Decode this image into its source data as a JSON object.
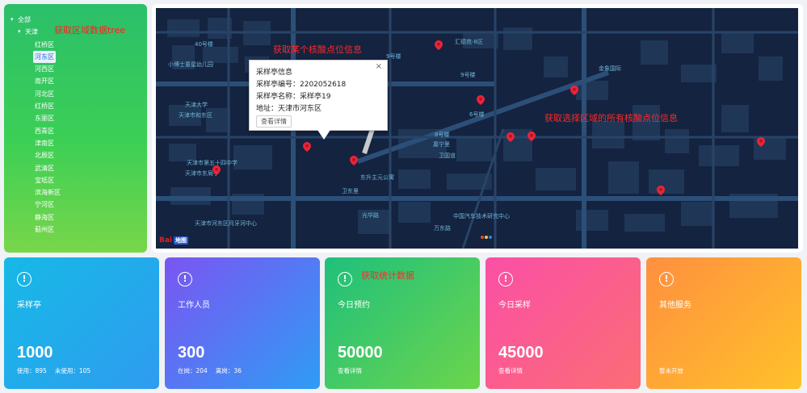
{
  "tree": {
    "annotation": "获取区域数据tree",
    "root": "全部",
    "city": "天津",
    "districts": [
      "红桥区",
      "河东区",
      "河西区",
      "南开区",
      "河北区",
      "红桥区",
      "东丽区",
      "西青区",
      "津南区",
      "北辰区",
      "武清区",
      "宝坻区",
      "滨海新区",
      "宁河区",
      "静海区",
      "蓟州区"
    ],
    "selected_index": 1
  },
  "map": {
    "annotation_point": "获取某个核酸点位信息",
    "annotation_region": "获取选择区域的所有核酸点位信息",
    "labels": [
      "40号楼",
      "小博士童星幼儿园",
      "天津大学",
      "天津市和东区",
      "天津市第五十四中学",
      "天津市东局子",
      "9号楼",
      "汇德苑-8区",
      "金象国际",
      "9号楼",
      "6号楼",
      "8号楼",
      "嘉宁里",
      "卫国道",
      "东升主元公寓",
      "光华路",
      "中国汽车技术研究中心",
      "万东路",
      "卫东里",
      "天津市河东区月牙河中心"
    ],
    "popup": {
      "title": "采样亭信息",
      "code": "采样亭编号：2202052618",
      "name": "采样亭名称：采样亭19",
      "address": "地址：天津市河东区",
      "button": "查看详情"
    },
    "logo_text": "Bai",
    "logo_badge": "地图"
  },
  "cards_annotation": "获取统计数据",
  "cards": [
    {
      "title": "采样亭",
      "value": "1000",
      "footer": [
        "使用：895",
        "未使用：105"
      ],
      "gradient": [
        "#16b9e6",
        "#2f9cf0"
      ]
    },
    {
      "title": "工作人员",
      "value": "300",
      "footer": [
        "在岗：204",
        "离岗：36"
      ],
      "gradient": [
        "#7b55f2",
        "#2f9cf5"
      ]
    },
    {
      "title": "今日预约",
      "value": "50000",
      "footer": [
        "查看详情"
      ],
      "gradient": [
        "#1fc07c",
        "#6cd54c"
      ]
    },
    {
      "title": "今日采样",
      "value": "45000",
      "footer": [
        "查看详情"
      ],
      "gradient": [
        "#fb4fa6",
        "#fb6d75"
      ]
    },
    {
      "title": "其他服务",
      "value": "",
      "footer": [
        "暂未开放"
      ],
      "gradient": [
        "#ff8f3f",
        "#ffc22a"
      ]
    }
  ]
}
